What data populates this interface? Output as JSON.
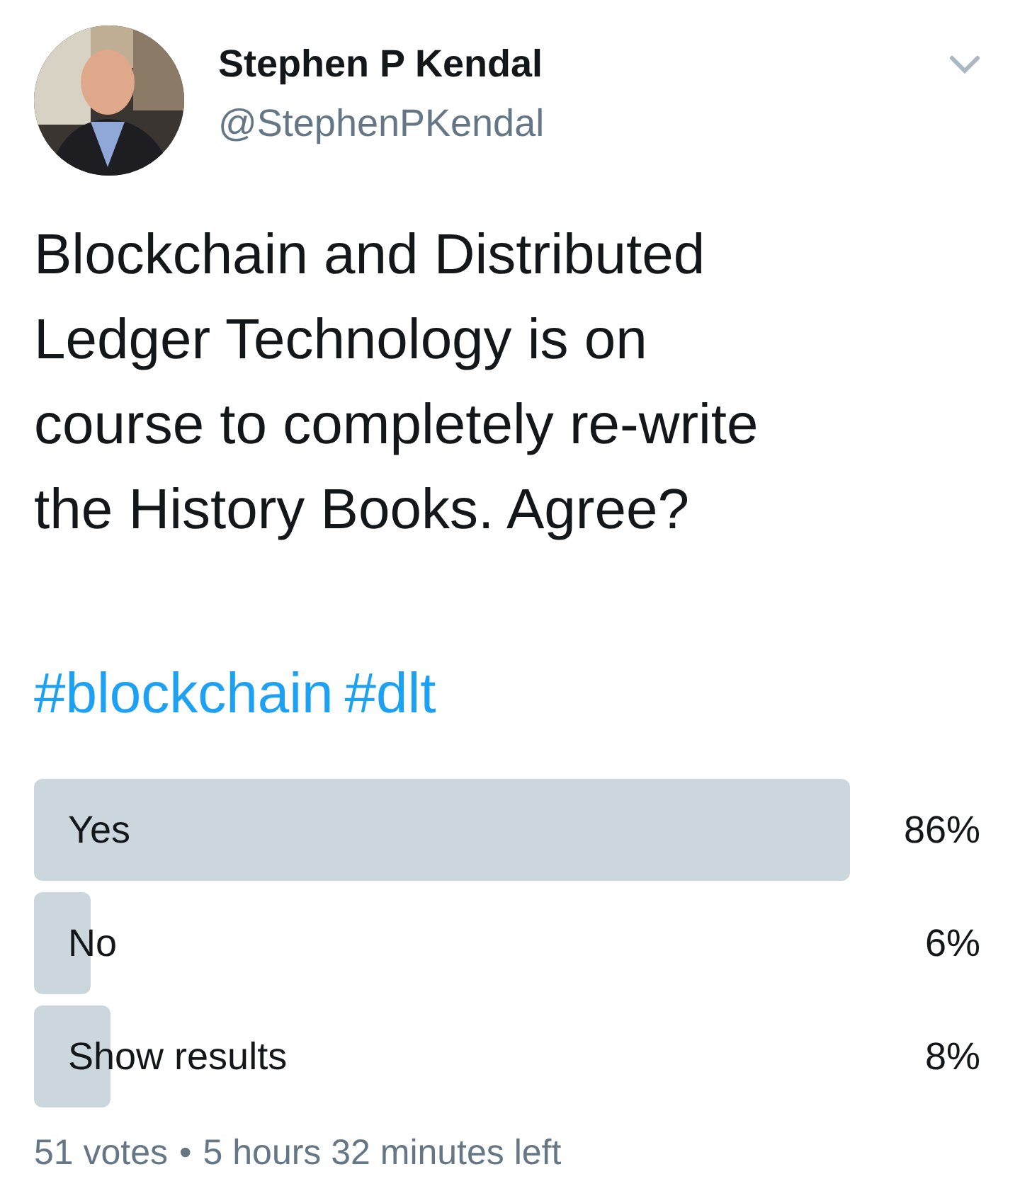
{
  "author": {
    "name": "Stephen P Kendal",
    "handle": "@StephenPKendal"
  },
  "menu": {
    "kind": "chevron"
  },
  "text_lines": [
    "Blockchain and Distributed",
    "Ledger Technology is on",
    "course to completely re-write",
    "the History Books. Agree?"
  ],
  "hashtags": [
    "#blockchain",
    "#dlt"
  ],
  "poll": {
    "options": [
      {
        "label": "Yes",
        "percent": "86%"
      },
      {
        "label": "No",
        "percent": "6%"
      },
      {
        "label": "Show results",
        "percent": "8%"
      }
    ],
    "votes": "51 votes",
    "separator": "•",
    "time_left": "5 hours 32 minutes left"
  }
}
